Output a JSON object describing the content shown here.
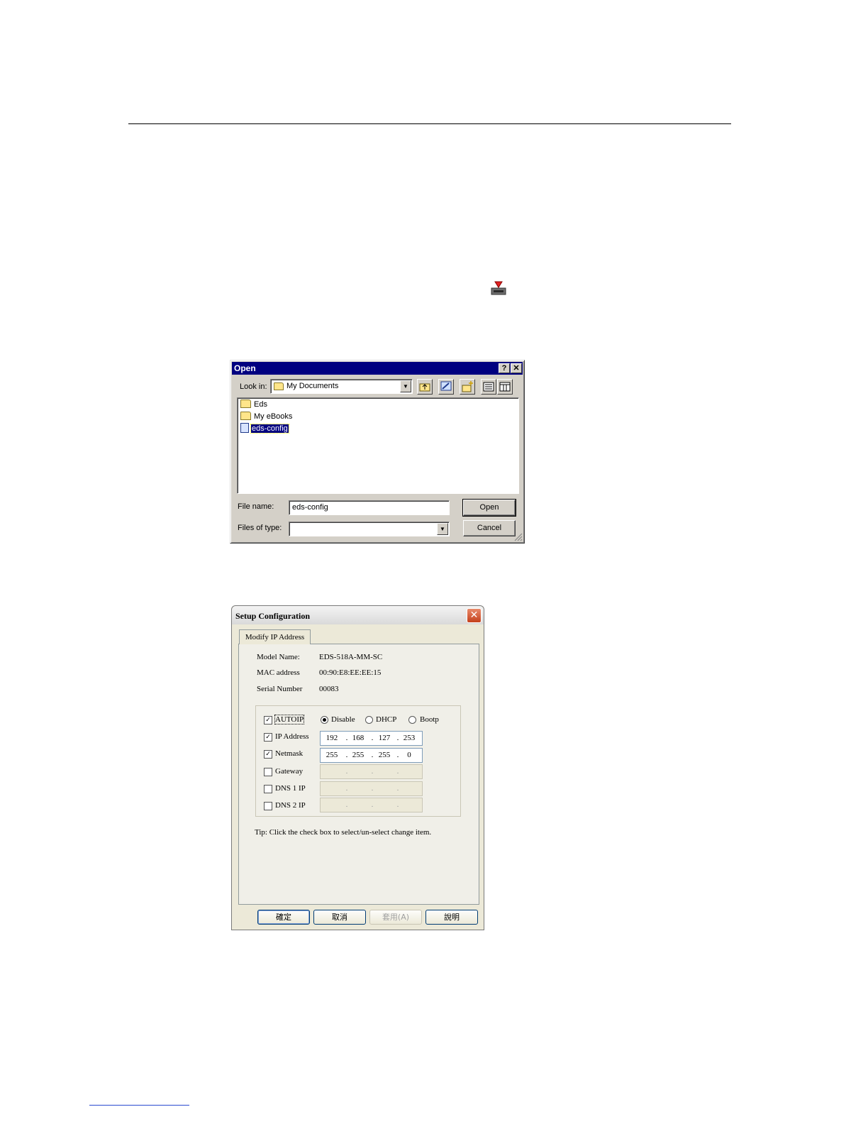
{
  "open_dialog": {
    "title": "Open",
    "help_btn": "?",
    "close_btn": "✕",
    "look_in_label": "Look in:",
    "look_in_value": "My Documents",
    "files": [
      {
        "name": "Eds",
        "type": "folder"
      },
      {
        "name": "My eBooks",
        "type": "folder"
      },
      {
        "name": "eds-config",
        "type": "file",
        "selected": true
      }
    ],
    "file_name_label": "File name:",
    "file_name_value": "eds-config",
    "files_of_type_label": "Files of type:",
    "files_of_type_value": "",
    "open_btn": "Open",
    "cancel_btn": "Cancel"
  },
  "setup_dialog": {
    "title": "Setup Configuration",
    "close_btn": "✕",
    "tab": "Modify IP Address",
    "model_name_label": "Model Name:",
    "model_name": "EDS-518A-MM-SC",
    "mac_label": "MAC address",
    "mac": "00:90:E8:EE:EE:15",
    "serial_label": "Serial Number",
    "serial": "00083",
    "autoip_label": "AUTOIP",
    "radio_disable": "Disable",
    "radio_dhcp": "DHCP",
    "radio_bootp": "Bootp",
    "ip_label": "IP Address",
    "ip": [
      "192",
      "168",
      "127",
      "253"
    ],
    "netmask_label": "Netmask",
    "netmask": [
      "255",
      "255",
      "255",
      "0"
    ],
    "gateway_label": "Gateway",
    "dns1_label": "DNS 1 IP",
    "dns2_label": "DNS 2 IP",
    "tip": "Tip: Click the check box to select/un-select change item.",
    "ok_btn": "確定",
    "cancel_btn": "取消",
    "apply_btn": "套用(A)",
    "help_btn": "說明"
  }
}
